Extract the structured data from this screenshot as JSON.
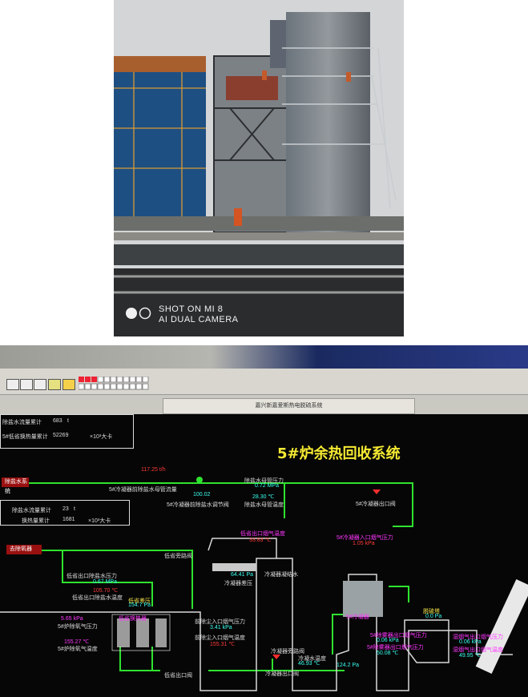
{
  "photo": {
    "caption_line1": "SHOT ON MI 8",
    "caption_line2": "AI DUAL CAMERA"
  },
  "hmi": {
    "window_title": "嘉兴新嘉爱斯热电脱硫系统",
    "main_title": "5#炉余热回收系统",
    "top_panel": {
      "row1_label": "除盐水流量累计",
      "row1_value": "683",
      "row1_unit": "t",
      "row2_label": "5#低省换热量累计",
      "row2_value": "52269",
      "row2_unit": "×10³大卡"
    },
    "mid_panel": {
      "row1_label": "除盐水流量累计",
      "row1_value": "23",
      "row1_unit": "t",
      "row2_label": "换热量累计",
      "row2_value": "1681",
      "row2_unit": "×10³大卡"
    },
    "tags": {
      "desalted_water_system": "除盐水系统",
      "from_deaerator": "去除氧器"
    },
    "labels": {
      "flow_rate": "117.25 t/h",
      "flow_label": "5#冷凝器前除盐水母管流量",
      "pressure_title": "除盐水母管压力",
      "pressure_value": "0.72 MPa",
      "temp_value": "28.30 ℃",
      "temp_title": "除盐水母管温度",
      "valve_1": "100.02",
      "valve_1_label": "5#冷凝器前除盐水调节阀",
      "outlet_valve": "5#冷凝器出口阀",
      "smoke_outlet_temp_title": "低省出口烟气温度",
      "smoke_outlet_temp": "33.83 ℃",
      "condenser_inlet": "5#冷凝器入口烟气压力",
      "condenser_inlet_value": "1.05 kPa",
      "low_save_bypass": "低省旁路阀",
      "low_save_outlet_pressure": "低省出口除盐水压力",
      "low_save_outlet_pressure_value": "0.67 MPa",
      "low_save_outlet_temp": "105.70 ℃",
      "low_save_outlet_temp_title": "低省出口除盐水温度",
      "condenser_pressure_value": "64.41 Pa",
      "condenser_pressure_title": "冷凝器差压",
      "low_save_diff": "低省差压",
      "low_save_diff_value": "154.7 Pa",
      "dust_pressure_value": "5.65 kPa",
      "dust_pressure_title": "5#炉除氧气压力",
      "dust_temp_value": "155.27 ℃",
      "dust_temp_title": "5#炉除氧气温度",
      "flue_inlet_pressure": "前除尘入口烟气压力",
      "flue_inlet_pressure_value": "3.41 kPa",
      "flue_inlet_temp": "前除尘入口烟气温度",
      "flue_inlet_temp_value": "155.31 ℃",
      "condenser_water": "冷凝水温度",
      "condenser_water_value": "46.93 ℃",
      "condenser_water_pressure_value": "124.2 Pa",
      "condenser_outlet_label": "冷凝器出口阀",
      "desulfur": "脱硫塔",
      "desulfur_value": "0.0 Pa",
      "right_pressure_1": "5#除雾器出口烟气压力",
      "right_pressure_1_value": "0.06 kPa",
      "right_pressure_2": "5#除雾器出口烟气压力",
      "right_pressure_2_value": "50.08 ℃",
      "right_box_1": "湿烟气出口烟气压力",
      "right_box_1_value": "0.06 kPa",
      "right_box_2": "湿烟气出口烟气温度",
      "right_box_2_value": "49.95 ℃",
      "low_save_bottom": "低省出口阀",
      "condenser_bypass": "冷凝器旁路阀",
      "condenser_header": "冷凝器凝结水",
      "hx_label_1": "低省换热器",
      "hx_label_2": "5#冷凝器"
    }
  }
}
